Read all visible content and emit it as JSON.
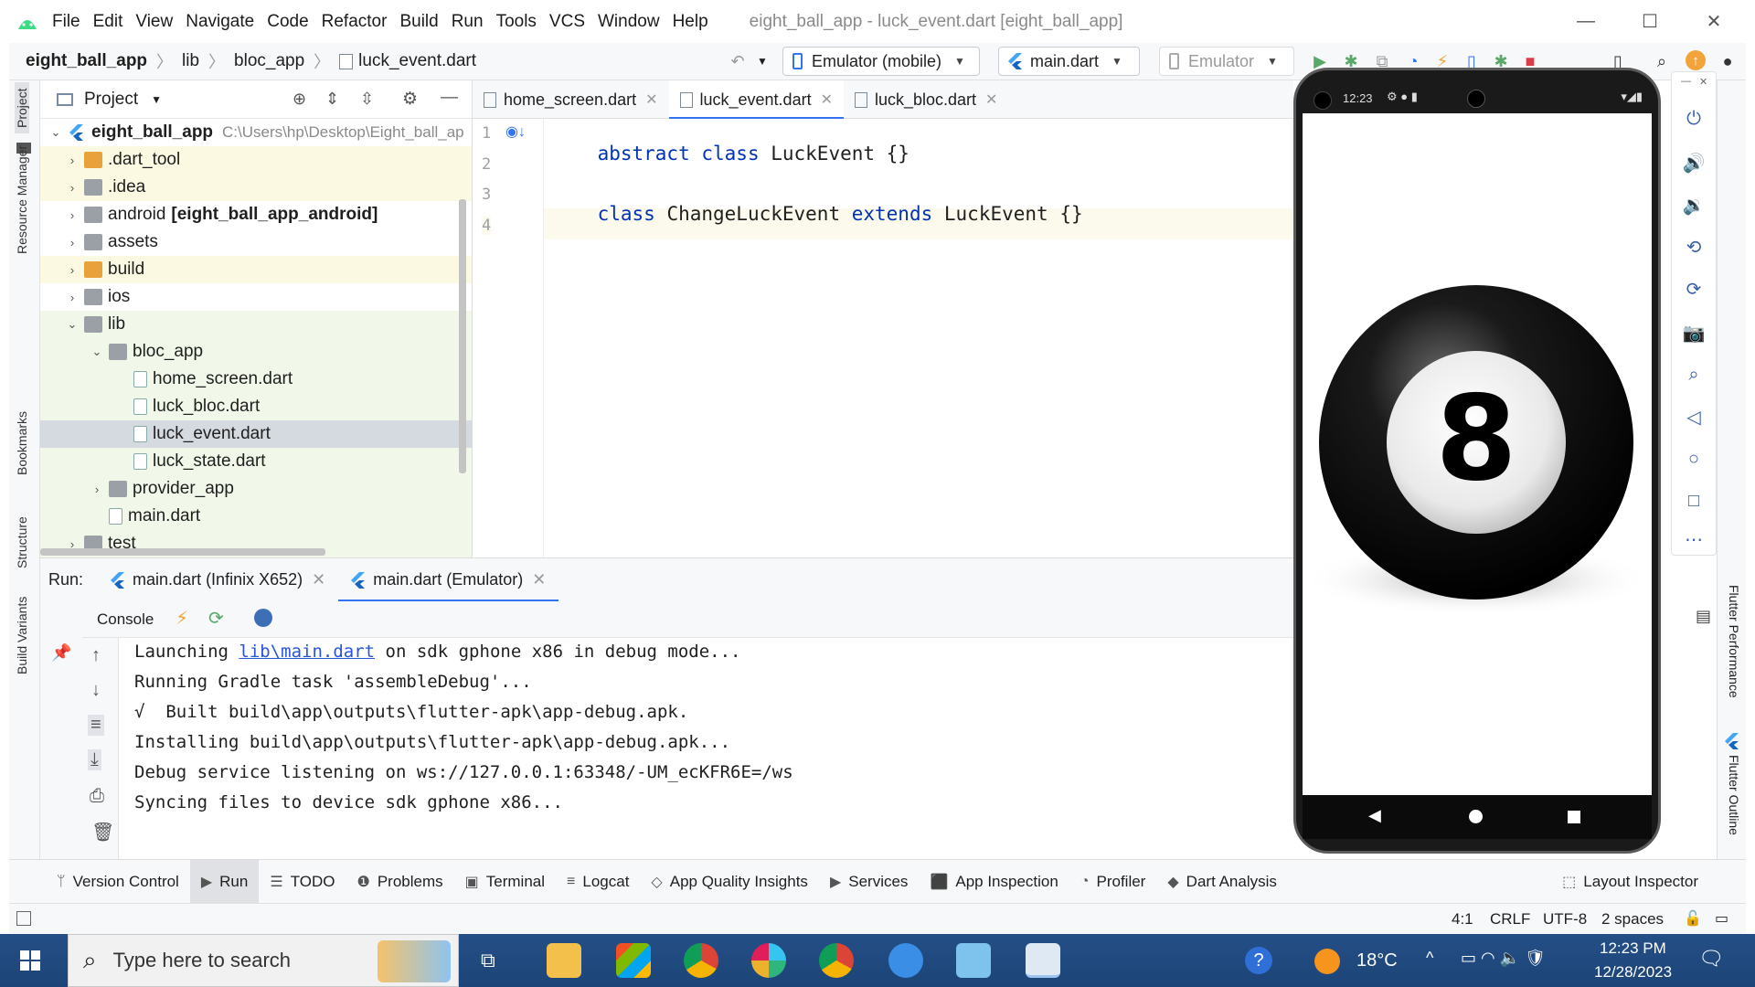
{
  "app": {
    "window_title": "eight_ball_app - luck_event.dart [eight_ball_app]",
    "menu": [
      "File",
      "Edit",
      "View",
      "Navigate",
      "Code",
      "Refactor",
      "Build",
      "Run",
      "Tools",
      "VCS",
      "Window",
      "Help"
    ]
  },
  "breadcrumb": [
    "eight_ball_app",
    "lib",
    "bloc_app",
    "luck_event.dart"
  ],
  "toolbar": {
    "device_selector": "Emulator (mobile)",
    "run_config": "main.dart",
    "emulator_selector": "Emulator"
  },
  "left_stripe": [
    "Project",
    "Resource Manager",
    "Bookmarks",
    "Structure",
    "Build Variants"
  ],
  "right_stripe": [
    "Flutter Performance",
    "Flutter Outline"
  ],
  "project_panel": {
    "title": "Project",
    "root_name": "eight_ball_app",
    "root_path": "C:\\Users\\hp\\Desktop\\Eight_ball_ap",
    "items": [
      {
        "label": ".dart_tool",
        "indent": 1,
        "expanded": false
      },
      {
        "label": ".idea",
        "indent": 1,
        "expanded": false
      },
      {
        "label": "android",
        "extra": "[eight_ball_app_android]",
        "indent": 1,
        "expanded": false
      },
      {
        "label": "assets",
        "indent": 1,
        "expanded": false
      },
      {
        "label": "build",
        "indent": 1,
        "expanded": false
      },
      {
        "label": "ios",
        "indent": 1,
        "expanded": false
      },
      {
        "label": "lib",
        "indent": 1,
        "expanded": true
      },
      {
        "label": "bloc_app",
        "indent": 2,
        "expanded": true
      },
      {
        "label": "home_screen.dart",
        "indent": 3
      },
      {
        "label": "luck_bloc.dart",
        "indent": 3
      },
      {
        "label": "luck_event.dart",
        "indent": 3,
        "selected": true
      },
      {
        "label": "luck_state.dart",
        "indent": 3
      },
      {
        "label": "provider_app",
        "indent": 2,
        "expanded": false
      },
      {
        "label": "main.dart",
        "indent": 2
      },
      {
        "label": "test",
        "indent": 1,
        "expanded": false
      }
    ]
  },
  "editor": {
    "tabs": [
      {
        "label": "home_screen.dart",
        "active": false
      },
      {
        "label": "luck_event.dart",
        "active": true
      },
      {
        "label": "luck_bloc.dart",
        "active": false
      }
    ],
    "line_numbers": [
      "1",
      "2",
      "3",
      "4"
    ],
    "lines": [
      [
        {
          "t": "abstract class",
          "k": true
        },
        {
          "t": " LuckEvent {}",
          "k": false
        }
      ],
      [],
      [
        {
          "t": "class",
          "k": true
        },
        {
          "t": " ChangeLuckEvent ",
          "k": false
        },
        {
          "t": "extends",
          "k": true
        },
        {
          "t": " LuckEvent {}",
          "k": false
        }
      ],
      []
    ]
  },
  "run_panel": {
    "label": "Run:",
    "tabs": [
      "main.dart (Infinix X652)",
      "main.dart (Emulator)"
    ],
    "console_label": "Console",
    "console": {
      "line1_prefix": "Launching ",
      "line1_link": "lib\\main.dart",
      "line1_suffix": " on sdk gphone x86 in debug mode...",
      "lines": [
        "Running Gradle task 'assembleDebug'...",
        "√  Built build\\app\\outputs\\flutter-apk\\app-debug.apk.",
        "Installing build\\app\\outputs\\flutter-apk\\app-debug.apk...",
        "Debug service listening on ws://127.0.0.1:63348/-UM_ecKFR6E=/ws",
        "Syncing files to device sdk gphone x86..."
      ]
    }
  },
  "emulator": {
    "status_time": "12:23",
    "ball_number": "8"
  },
  "tool_windows": [
    "Version Control",
    "Run",
    "TODO",
    "Problems",
    "Terminal",
    "Logcat",
    "App Quality Insights",
    "Services",
    "App Inspection",
    "Profiler",
    "Dart Analysis"
  ],
  "layout_inspector": "Layout Inspector",
  "status_bar": {
    "position": "4:1",
    "line_sep": "CRLF",
    "encoding": "UTF-8",
    "indent": "2 spaces"
  },
  "taskbar": {
    "search_placeholder": "Type here to search",
    "weather": "18°C",
    "time": "12:23 PM",
    "date": "12/28/2023"
  },
  "colors": {
    "accent": "#3574f0",
    "keyword": "#0033b3",
    "run_green": "#59a869",
    "stop_red": "#db3b4b",
    "taskbar": "#1e4f8a"
  }
}
